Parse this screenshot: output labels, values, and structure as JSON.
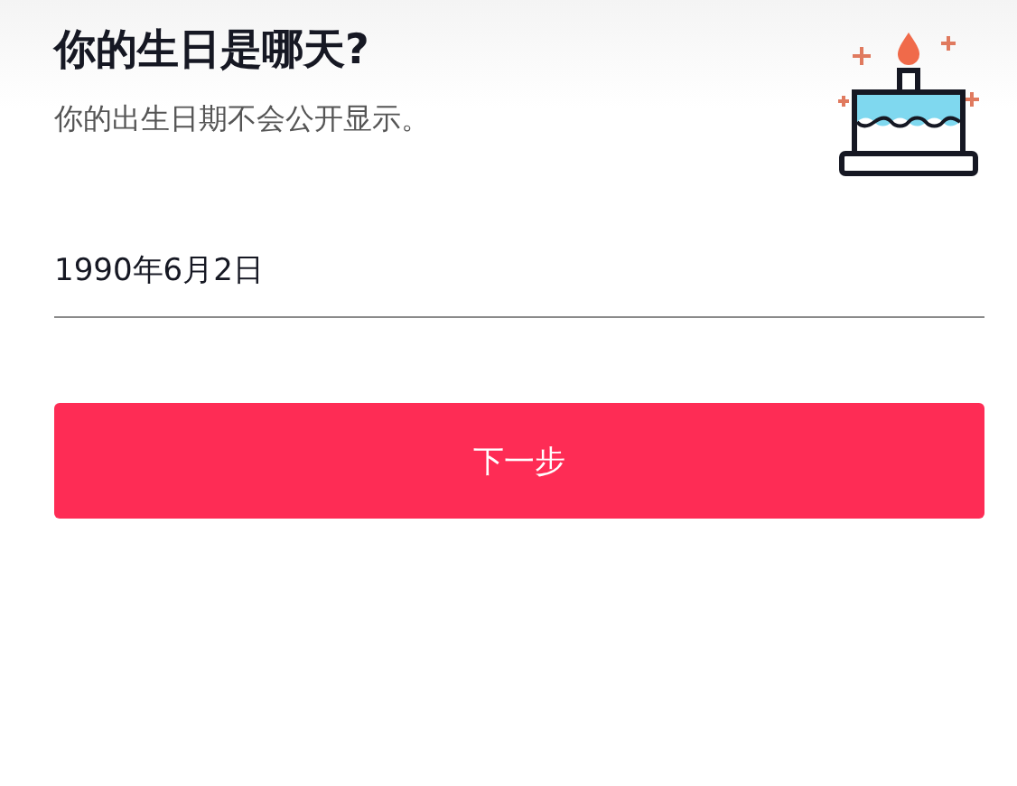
{
  "header": {
    "title": "你的生日是哪天?",
    "subtitle": "你的出生日期不会公开显示。"
  },
  "birthday_field": {
    "value": "1990年6月2日"
  },
  "buttons": [
    "下一步"
  ]
}
